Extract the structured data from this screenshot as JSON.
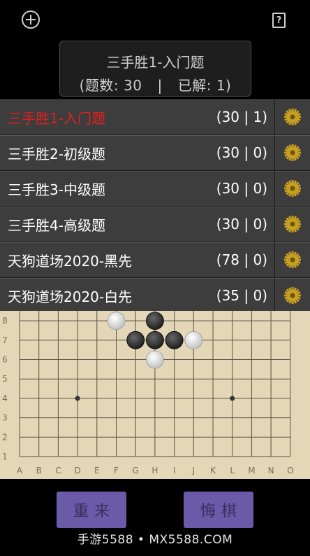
{
  "header": {
    "add_icon": "plus-circle-icon",
    "help_icon": "question-box-icon"
  },
  "title": {
    "line1": "三手胜1-入门题",
    "count_label": "(题数:  30",
    "separator": "|",
    "solved_label": "已解:  1)"
  },
  "problem_sets": [
    {
      "name": "三手胜1-入门题",
      "stats": "(30 | 1)",
      "active": true
    },
    {
      "name": "三手胜2-初级题",
      "stats": "(30 | 0)",
      "active": false
    },
    {
      "name": "三手胜3-中级题",
      "stats": "(30 | 0)",
      "active": false
    },
    {
      "name": "三手胜4-高级题",
      "stats": "(30 | 0)",
      "active": false
    },
    {
      "name": "天狗道场2020-黑先",
      "stats": "(78 | 0)",
      "active": false
    },
    {
      "name": "天狗道场2020-白先",
      "stats": "(35 | 0)",
      "active": false
    }
  ],
  "board": {
    "col_labels": [
      "A",
      "B",
      "C",
      "D",
      "E",
      "F",
      "G",
      "H",
      "I",
      "J",
      "K",
      "L",
      "M",
      "N",
      "O"
    ],
    "row_labels": [
      "1",
      "2",
      "3",
      "4",
      "5",
      "6",
      "7",
      "8"
    ],
    "stones": [
      {
        "col": "F",
        "row": 8,
        "color": "white"
      },
      {
        "col": "H",
        "row": 8,
        "color": "black"
      },
      {
        "col": "G",
        "row": 7,
        "color": "black"
      },
      {
        "col": "H",
        "row": 7,
        "color": "black"
      },
      {
        "col": "I",
        "row": 7,
        "color": "black"
      },
      {
        "col": "J",
        "row": 7,
        "color": "white"
      },
      {
        "col": "H",
        "row": 6,
        "color": "white"
      }
    ],
    "star_points": [
      {
        "col": "D",
        "row": 4
      },
      {
        "col": "L",
        "row": 4
      }
    ]
  },
  "buttons": {
    "restart": "重来",
    "undo": "悔棋"
  },
  "watermark": "手游5588 • MX5588.COM",
  "colors": {
    "active_text": "#e02020",
    "row_bg": "#3d3d3d",
    "board_bg": "#e3d7b8",
    "button_bg": "#6a5aa8",
    "gear": "#c8a020"
  }
}
